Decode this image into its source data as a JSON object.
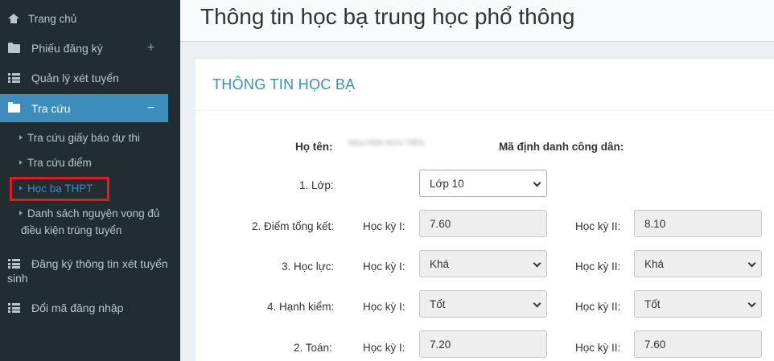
{
  "sidebar": {
    "items": [
      {
        "label": "Trang chủ",
        "icon": "home-icon"
      },
      {
        "label": "Phiếu đăng ký",
        "icon": "folder-icon",
        "toggle": "+"
      },
      {
        "label": "Quản lý xét tuyển",
        "icon": "list-icon"
      },
      {
        "label": "Tra cứu",
        "icon": "folder-open-icon",
        "toggle": "−"
      },
      {
        "label": "Đăng ký thông tin xét tuyển",
        "label2": "sinh",
        "icon": "list-icon"
      },
      {
        "label": "Đổi mã đăng nhập",
        "icon": "list-icon"
      }
    ],
    "subitems": [
      {
        "label": "Tra cứu giấy báo dự thi"
      },
      {
        "label": "Tra cứu điểm"
      },
      {
        "label": "Học bạ THPT"
      },
      {
        "label": "Danh sách nguyện vọng đủ",
        "label2": "điều kiện trúng tuyển"
      }
    ],
    "active_color": "#3c8dbc",
    "bg_color": "#222d32",
    "highlight_color": "#e21b22"
  },
  "header": {
    "title": "Thông tin học bạ trung học phổ thông"
  },
  "box": {
    "title": "THÔNG TIN HỌC BẠ",
    "name_label": "Họ tên:",
    "name_value": "NGUYỄN HỮU TIẾN",
    "id_label": "Mã định danh công dân:",
    "class_label": "1. Lớp:",
    "class_value": "Lớp 10",
    "sem1_label": "Học kỳ I:",
    "sem2_label": "Học kỳ II:",
    "rows": [
      {
        "label": "2. Điểm tổng kết:",
        "s1": "7.60",
        "s2": "8.10"
      },
      {
        "label": "3. Học lực:",
        "s1": "Khá",
        "s2": "Khá"
      },
      {
        "label": "4. Hạnh kiểm:",
        "s1": "Tốt",
        "s2": "Tốt"
      },
      {
        "label": "2. Toán:",
        "s1": "7.20",
        "s2": "7.60"
      }
    ]
  }
}
